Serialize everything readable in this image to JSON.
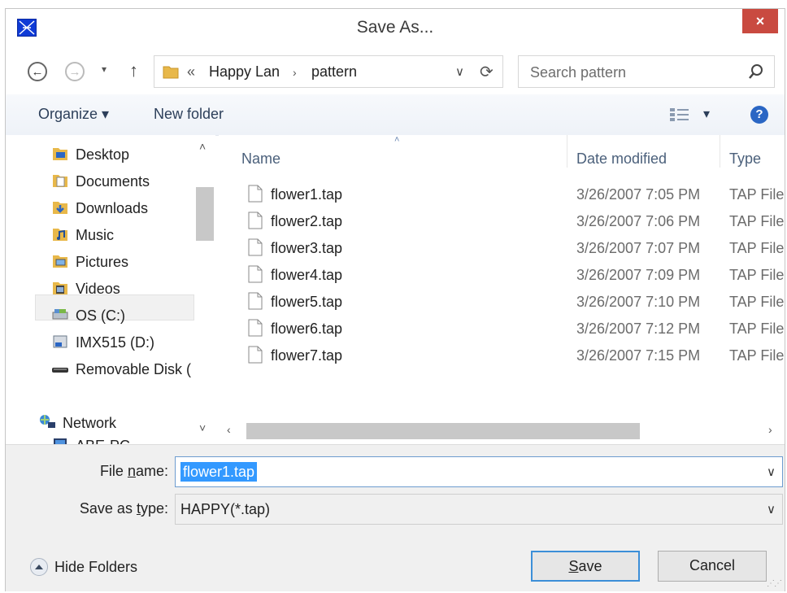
{
  "window": {
    "title": "Save As...",
    "close_label": "×"
  },
  "nav_buttons": {
    "back": "←",
    "forward": "→",
    "recent": "▾",
    "up": "↑"
  },
  "address": {
    "overflow": "«",
    "crumbs": [
      "Happy Lan",
      "pattern"
    ],
    "separator": "›",
    "dropdown": "∨",
    "refresh": "⟳"
  },
  "search": {
    "placeholder": "Search pattern"
  },
  "toolbar": {
    "organize_label": "Organize ▾",
    "new_folder_label": "New folder",
    "views_arrow": "▾",
    "help_label": "?"
  },
  "sidebar": {
    "items": [
      {
        "label": "Desktop",
        "icon": "desktop-folder-icon"
      },
      {
        "label": "Documents",
        "icon": "documents-folder-icon"
      },
      {
        "label": "Downloads",
        "icon": "downloads-folder-icon"
      },
      {
        "label": "Music",
        "icon": "music-folder-icon"
      },
      {
        "label": "Pictures",
        "icon": "pictures-folder-icon"
      },
      {
        "label": "Videos",
        "icon": "videos-folder-icon"
      },
      {
        "label": "OS (C:)",
        "icon": "hard-drive-icon",
        "selected": true
      },
      {
        "label": "IMX515 (D:)",
        "icon": "drive-icon"
      },
      {
        "label": "Removable Disk (",
        "icon": "removable-disk-icon"
      },
      {
        "label": "Network",
        "icon": "network-icon"
      },
      {
        "label": "ABE-PC",
        "icon": "computer-icon"
      }
    ],
    "scroll_up": "˄",
    "scroll_down": "˅"
  },
  "files": {
    "columns": {
      "name": "Name",
      "date": "Date modified",
      "type": "Type"
    },
    "sort_indicator": "˄",
    "rows": [
      {
        "name": "flower1.tap",
        "date": "3/26/2007 7:05 PM",
        "type": "TAP File"
      },
      {
        "name": "flower2.tap",
        "date": "3/26/2007 7:06 PM",
        "type": "TAP File"
      },
      {
        "name": "flower3.tap",
        "date": "3/26/2007 7:07 PM",
        "type": "TAP File"
      },
      {
        "name": "flower4.tap",
        "date": "3/26/2007 7:09 PM",
        "type": "TAP File"
      },
      {
        "name": "flower5.tap",
        "date": "3/26/2007 7:10 PM",
        "type": "TAP File"
      },
      {
        "name": "flower6.tap",
        "date": "3/26/2007 7:12 PM",
        "type": "TAP File"
      },
      {
        "name": "flower7.tap",
        "date": "3/26/2007 7:15 PM",
        "type": "TAP File"
      }
    ],
    "scroll_left": "‹",
    "scroll_right": "›"
  },
  "save_form": {
    "file_name_label_pre": "File ",
    "file_name_label_ul": "n",
    "file_name_label_post": "ame:",
    "file_name_value": "flower1.tap",
    "save_type_label_pre": "Save as ",
    "save_type_label_ul": "t",
    "save_type_label_post": "ype:",
    "save_type_value": "HAPPY(*.tap)",
    "dropdown": "∨"
  },
  "footer": {
    "hide_folders_label": "Hide Folders",
    "save_label_ul": "S",
    "save_label_post": "ave",
    "cancel_label": "Cancel"
  },
  "colors": {
    "accent": "#3399ff",
    "close": "#c94a40",
    "header_text": "#4b607b"
  }
}
